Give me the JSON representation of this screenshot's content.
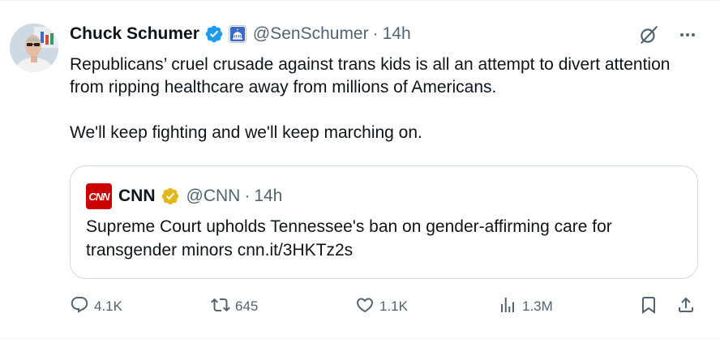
{
  "author": {
    "name": "Chuck Schumer",
    "handle": "@SenSchumer",
    "separator": "·",
    "time": "14h"
  },
  "tweet": {
    "paragraphs": [
      "Republicans’ cruel crusade against trans kids is all an attempt to divert attention from ripping healthcare away from millions of Americans.",
      "We'll keep fighting and we'll keep marching on."
    ]
  },
  "quote": {
    "logo_text": "CNN",
    "name": "CNN",
    "handle": "@CNN",
    "separator": "·",
    "time": "14h",
    "text": "Supreme Court upholds Tennessee's ban on gender-affirming care for transgender minors cnn.it/3HKTz2s"
  },
  "actions": {
    "replies": "4.1K",
    "reposts": "645",
    "likes": "1.1K",
    "views": "1.3M"
  },
  "icons": {
    "top_right": [
      "grok-icon",
      "more-icon"
    ],
    "badges": [
      "verified-blue-icon",
      "government-badge-icon",
      "verified-gold-icon"
    ],
    "actions": [
      "reply-icon",
      "repost-icon",
      "like-icon",
      "views-icon",
      "bookmark-icon",
      "share-icon"
    ]
  },
  "colors": {
    "text": "#0f1419",
    "muted": "#536471",
    "verified_blue": "#1d9bf0",
    "verified_gold": "#e2b719",
    "cnn_red": "#cc0000",
    "border": "#cfd9de"
  }
}
